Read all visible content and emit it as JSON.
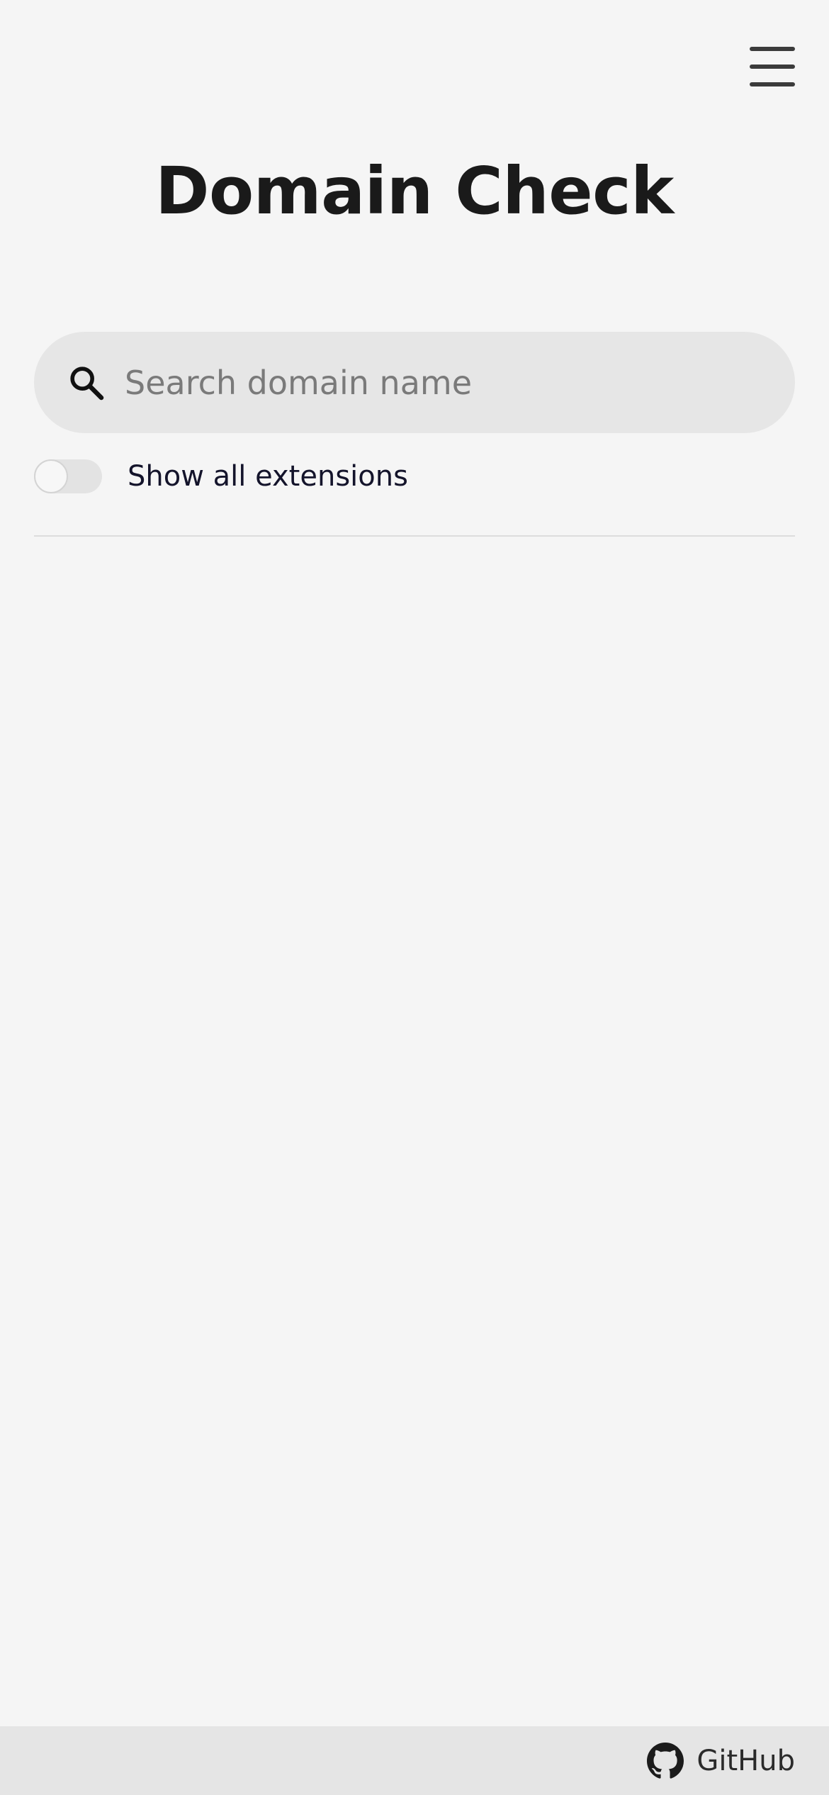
{
  "header": {
    "menu_icon": "hamburger-menu-icon"
  },
  "main": {
    "title": "Domain Check",
    "search": {
      "icon": "search-icon",
      "placeholder": "Search domain name",
      "value": ""
    },
    "toggle": {
      "label": "Show all extensions",
      "checked": false
    }
  },
  "footer": {
    "github_label": "GitHub",
    "github_icon": "github-icon"
  },
  "colors": {
    "background": "#f5f5f5",
    "search_background": "#e6e6e6",
    "footer_background": "#e5e5e5",
    "text": "#1a1a1a"
  }
}
